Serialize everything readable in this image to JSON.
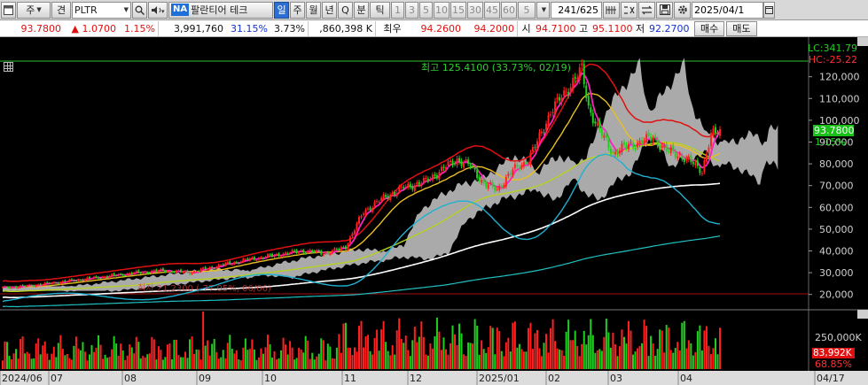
{
  "toolbar": {
    "market": "주",
    "type": "견",
    "symbol": "PLTR",
    "na_badge": "NA",
    "name": "팔란티어 테크",
    "periods": [
      "일",
      "주",
      "월",
      "년",
      "Q",
      "분",
      "틱"
    ],
    "active_period": "일",
    "intervals": [
      "1",
      "3",
      "5",
      "10",
      "15",
      "30",
      "45",
      "60",
      "5"
    ],
    "count": "241/625",
    "date": "2025/04/1"
  },
  "quote": {
    "price": "93.7800",
    "change": "▲ 1.0700",
    "change_pct": "1.15%",
    "volume": "3,991,760",
    "vol_ratio": "31.15%",
    "turnover_pct": "3.73%",
    "amount": ",860,398 K",
    "best_label": "최우",
    "ask": "94.2600",
    "bid": "94.2000",
    "open_label": "시",
    "open": "94.7100",
    "high_label": "고",
    "high": "95.1100",
    "low_label": "저",
    "low": "92.2700",
    "buy_label": "매수",
    "sell_label": "매도"
  },
  "chart_data": {
    "type": "line",
    "title": "",
    "price_annotation": "최고 125.4100 (33.73%, 02/19)",
    "low_annotation": "최저 21.2300 (-77.05%, 06/06)",
    "lc_label": "LC:341.79",
    "hc_label": "HC:-25.22",
    "current_price": "93.7800",
    "current_change": "1.15%",
    "y_ticks": [
      "120,000",
      "110,000",
      "100,000",
      "90,000",
      "80,000",
      "70,000",
      "60,000",
      "50,000",
      "40,000",
      "30,000",
      "20,000"
    ],
    "y_tick_values": [
      120,
      110,
      100,
      90,
      80,
      70,
      60,
      50,
      40,
      30,
      20
    ],
    "ylim": [
      15,
      128
    ],
    "volume_tick": "250,000K",
    "current_volume": "83,992K",
    "current_volume_pct": "68.85%",
    "x_labels": [
      "2024/06",
      "07",
      "08",
      "09",
      "10",
      "11",
      "12",
      "2025/01",
      "02",
      "03",
      "04",
      "04/17"
    ],
    "colors": {
      "up": "#ff2020",
      "down": "#20d020",
      "upper_band": "#e01010",
      "ma_fast": "#ff20c0",
      "ma_mid": "#e8c020",
      "ma_slow": "#b8d020",
      "ma_cyan": "#20b0d0",
      "ma_white": "#ffffff",
      "ma_teal": "#20c0c0",
      "cloud": "#c8c8c8"
    }
  }
}
